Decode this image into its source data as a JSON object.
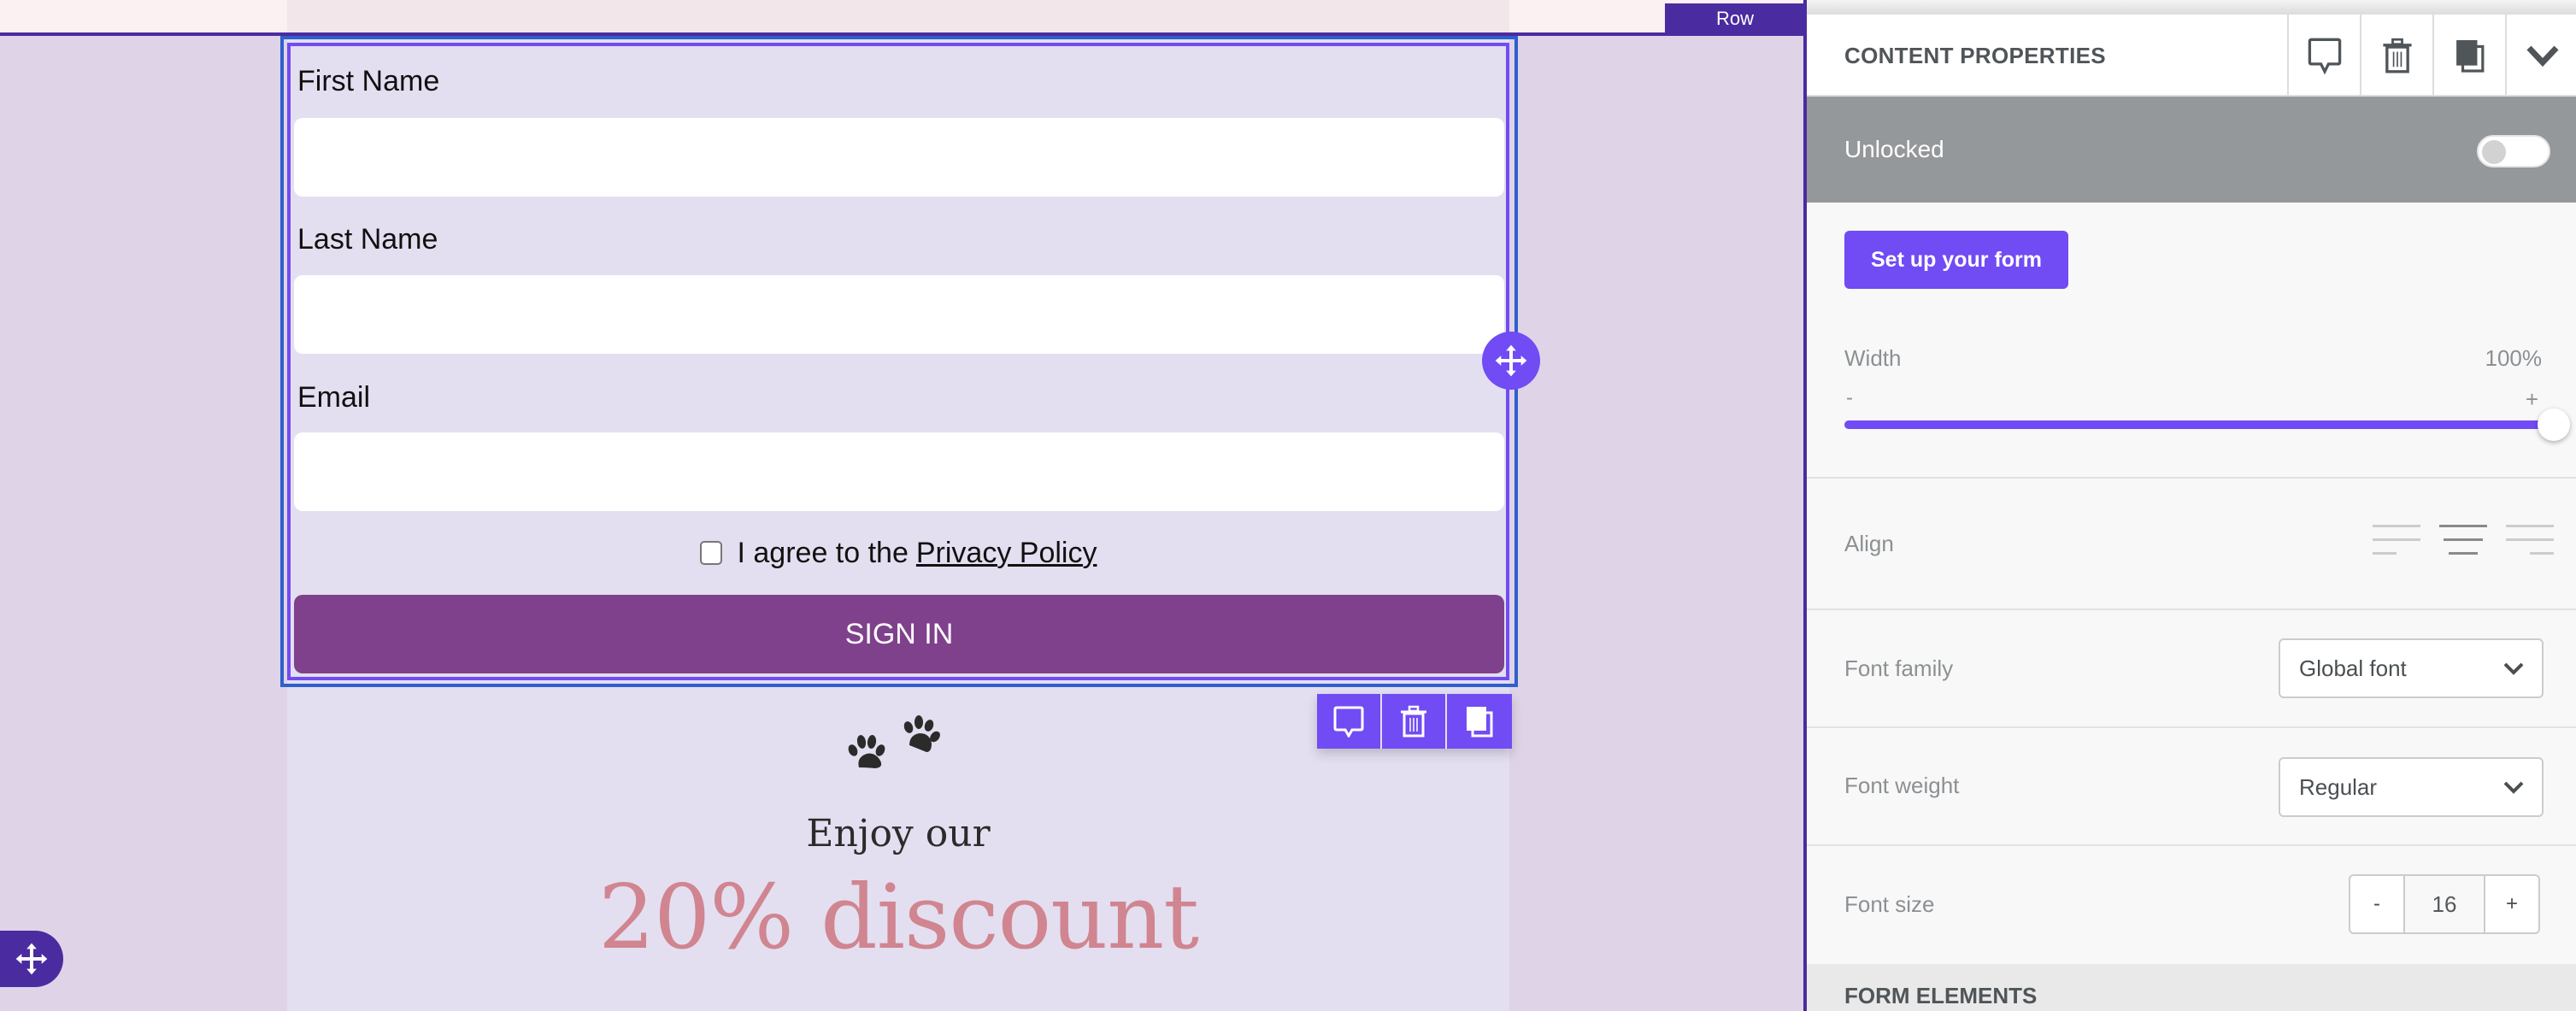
{
  "canvas": {
    "row_tab_label": "Row",
    "form": {
      "fields": [
        {
          "label": "First Name",
          "value": "",
          "placeholder": ""
        },
        {
          "label": "Last Name",
          "value": "",
          "placeholder": ""
        },
        {
          "label": "Email",
          "value": "",
          "placeholder": ""
        }
      ],
      "agree_text": "I agree to the",
      "agree_link": "Privacy Policy",
      "agree_checked": false,
      "submit_label": "SIGN IN"
    },
    "toolbar": {
      "icons": [
        "comment-icon",
        "trash-icon",
        "duplicate-icon"
      ]
    },
    "promo": {
      "icon": "paw-prints-icon",
      "line1": "Enjoy our",
      "line2": "20% discount"
    },
    "colors": {
      "selection_outer": "#2e5fcc",
      "selection_inner": "#714bf4",
      "row_accent": "#4a2ba0",
      "submit_bg": "#7f418b",
      "discount_text": "#d08590"
    }
  },
  "panel": {
    "title": "CONTENT PROPERTIES",
    "header_icons": [
      "comment-icon",
      "trash-icon",
      "duplicate-icon",
      "chevron-down-icon"
    ],
    "lock": {
      "label": "Unlocked",
      "on": false
    },
    "setup_button": "Set up your form",
    "width": {
      "label": "Width",
      "value_text": "100%",
      "value": 100,
      "min_label": "-",
      "max_label": "+"
    },
    "align": {
      "label": "Align",
      "options": [
        "left",
        "center",
        "right"
      ],
      "selected": "center"
    },
    "font_family": {
      "label": "Font family",
      "value": "Global font"
    },
    "font_weight": {
      "label": "Font weight",
      "value": "Regular"
    },
    "font_size": {
      "label": "Font size",
      "value": "16",
      "minus": "-",
      "plus": "+"
    },
    "section_title": "FORM ELEMENTS",
    "accent": "#714bf4"
  }
}
